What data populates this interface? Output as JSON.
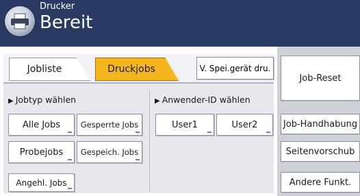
{
  "header": {
    "subtitle": "Drucker",
    "title": "Bereit"
  },
  "tabs": [
    {
      "label": "Jobliste",
      "active": false
    },
    {
      "label": "Druckjobs",
      "active": true
    }
  ],
  "storage_button": "V. Spei.gerät dru.",
  "sections": {
    "job_type": "Jobtyp wählen",
    "user_id": "Anwender-ID wählen"
  },
  "job_types": [
    "Alle Jobs",
    "Gesperrte Jobs",
    "Probejobs",
    "Gespeich. Jobs",
    "Angehl. Jobs"
  ],
  "users": [
    "User1",
    "User2"
  ],
  "right_buttons": [
    "Job-Reset",
    "Job-Handhabung",
    "Seitenvorschub",
    "Andere Funkt."
  ],
  "colors": {
    "header": "#2b3a63",
    "active_tab": "#f4b51d"
  }
}
